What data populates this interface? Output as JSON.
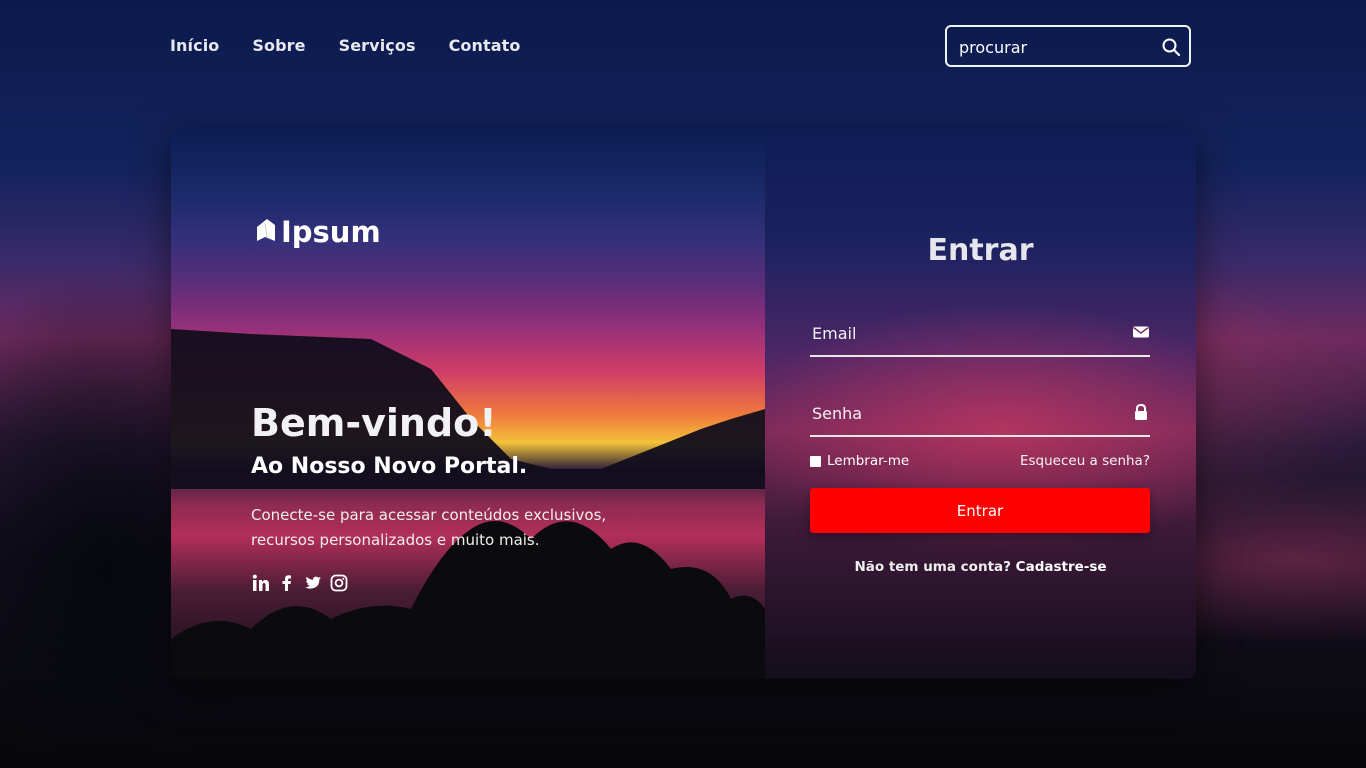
{
  "nav": {
    "items": [
      {
        "label": "Início"
      },
      {
        "label": "Sobre"
      },
      {
        "label": "Serviços"
      },
      {
        "label": "Contato"
      }
    ],
    "search": {
      "placeholder": "procurar",
      "icon": "search-icon"
    }
  },
  "hero": {
    "logo_text": "Ipsum",
    "logo_icon": "leaf-book-icon",
    "welcome": "Bem-vindo!",
    "subtitle": "Ao Nosso Novo Portal.",
    "description": "Conecte-se para acessar conteúdos exclusivos, recursos personalizados e muito mais.",
    "social": [
      "linkedin-icon",
      "facebook-icon",
      "twitter-icon",
      "instagram-icon"
    ]
  },
  "login": {
    "title": "Entrar",
    "email_placeholder": "Email",
    "email_icon": "envelope-icon",
    "password_placeholder": "Senha",
    "password_icon": "lock-icon",
    "remember_label": "Lembrar-me",
    "forgot_label": "Esqueceu a senha?",
    "submit_label": "Entrar",
    "signup_prompt": "Não tem uma conta?",
    "signup_link": "Cadastre-se"
  },
  "colors": {
    "accent_button": "#ff0000",
    "text": "#ffffff"
  }
}
